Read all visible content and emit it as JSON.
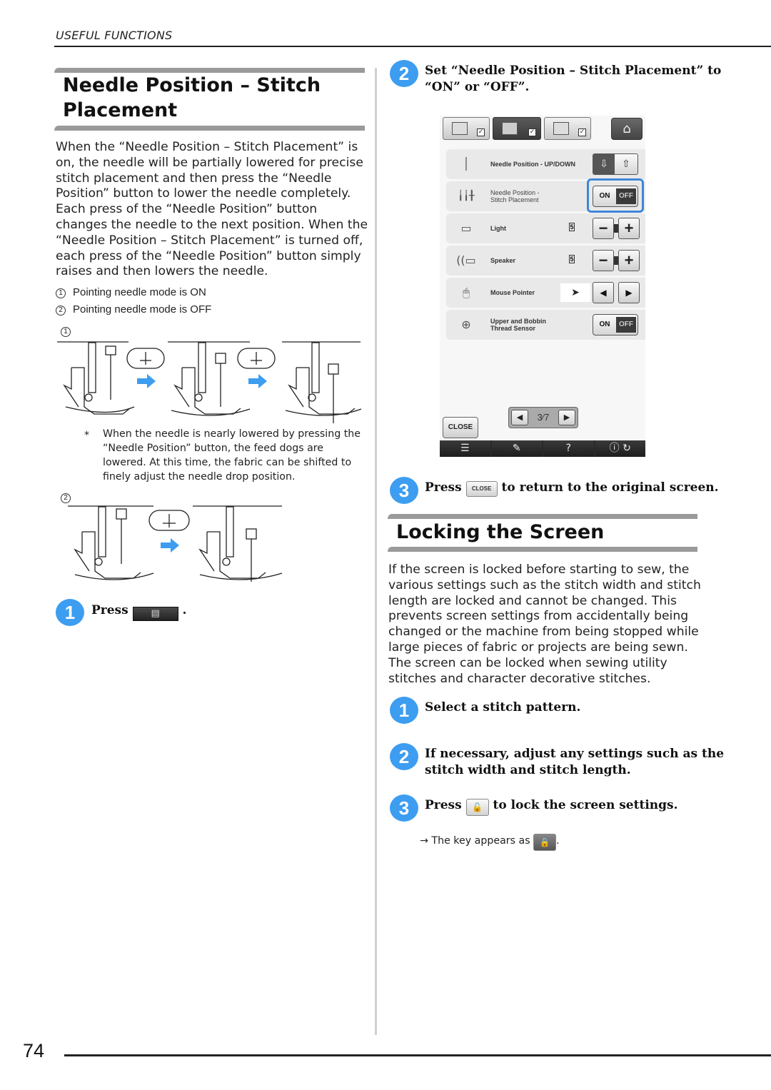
{
  "header": {
    "running_head": "USEFUL FUNCTIONS"
  },
  "left": {
    "section_title_line1": "Needle Position – Stitch",
    "section_title_line2": "Placement",
    "intro_lines": [
      "When the “Needle Position – Stitch Placement” is",
      "on, the needle will be partially lowered for precise",
      "stitch placement and then press the “Needle",
      "Position” button to lower the needle completely.",
      "Each press of the “Needle Position” button",
      "changes the needle to the next position. When the",
      "“Needle Position – Stitch Placement” is turned off,",
      "each press of the “Needle Position” button simply",
      "raises and then lowers the needle."
    ],
    "legend": [
      {
        "marker": "1",
        "text": "Pointing needle mode is ON"
      },
      {
        "marker": "2",
        "text": "Pointing needle mode is OFF"
      }
    ],
    "figure1_marker": "1",
    "figure2_marker": "2",
    "note_marker": "*",
    "note_lines": [
      "When the needle is nearly lowered by pressing the",
      "“Needle Position” button, the feed dogs are",
      "lowered. At this time, the fabric can be shifted to",
      "finely adjust the needle drop position."
    ],
    "step1": {
      "number": "1",
      "prefix": "Press",
      "suffix": ".",
      "button_icon": "settings-page-icon"
    },
    "arrow_color": "#3d9df0"
  },
  "right": {
    "step2": {
      "number": "2",
      "line1": "Set “Needle Position – Stitch Placement” to",
      "line2": "“ON” or “OFF”."
    },
    "screen": {
      "tabs": [
        {
          "name": "common-settings",
          "selected": false
        },
        {
          "name": "sewing-settings",
          "selected": true
        },
        {
          "name": "embroidery-settings",
          "selected": false
        }
      ],
      "home_icon": "⌂",
      "rows": [
        {
          "label_line1": "Needle Position - UP/DOWN",
          "label_line2": "",
          "control": "up-down",
          "value": ""
        },
        {
          "label_line1": "Needle Position -",
          "label_line2": "Stitch Placement",
          "control": "on-off",
          "on_label": "ON",
          "off_label": "OFF",
          "highlighted": true
        },
        {
          "label_line1": "Light",
          "label_line2": "",
          "control": "plus-minus",
          "value": "5",
          "minus": "−",
          "plus": "+"
        },
        {
          "label_line1": "Speaker",
          "label_line2": "",
          "control": "plus-minus",
          "value": "5",
          "minus": "−",
          "plus": "+"
        },
        {
          "label_line1": "Mouse Pointer",
          "label_line2": "",
          "control": "pointer-select",
          "prev": "◀",
          "next": "▶",
          "pointer": "➤"
        },
        {
          "label_line1": "Upper and Bobbin",
          "label_line2": "Thread Sensor",
          "control": "on-off",
          "on_label": "ON",
          "off_label": "OFF",
          "highlighted": false
        }
      ],
      "pager": {
        "prev": "◀",
        "next": "▶",
        "current": "3",
        "total": "7",
        "display": "3⁄7"
      },
      "close_label": "CLOSE",
      "bottom_bar": [
        "☰",
        "✎",
        "?",
        "ⓘ ↻"
      ],
      "highlight_color": "#3f86d8"
    },
    "step3": {
      "number": "3",
      "prefix": "Press",
      "button_label": "CLOSE",
      "suffix": "to return to the original screen."
    },
    "section2_title": "Locking the Screen",
    "lock_intro_lines": [
      "If the screen is locked before starting to sew, the",
      "various settings such as the stitch width and stitch",
      "length are locked and cannot be changed. This",
      "prevents screen settings from accidentally being",
      "changed or the machine from being stopped while",
      "large pieces of fabric or projects are being sewn.",
      "The screen can be locked when sewing utility",
      "stitches and character decorative stitches."
    ],
    "lock_steps": [
      {
        "number": "1",
        "line1": "Select a stitch pattern.",
        "line2": ""
      },
      {
        "number": "2",
        "line1": "If necessary, adjust any settings such as the",
        "line2": "stitch width and stitch length."
      },
      {
        "number": "3",
        "prefix": "Press",
        "suffix": "to lock the screen settings."
      }
    ],
    "result": {
      "arrow": "→",
      "text": "The key appears as",
      "suffix": "."
    }
  },
  "footer": {
    "page_number": "74"
  },
  "colors": {
    "step_badge": "#3d9df0",
    "section_bar": "#9a9a9a"
  }
}
